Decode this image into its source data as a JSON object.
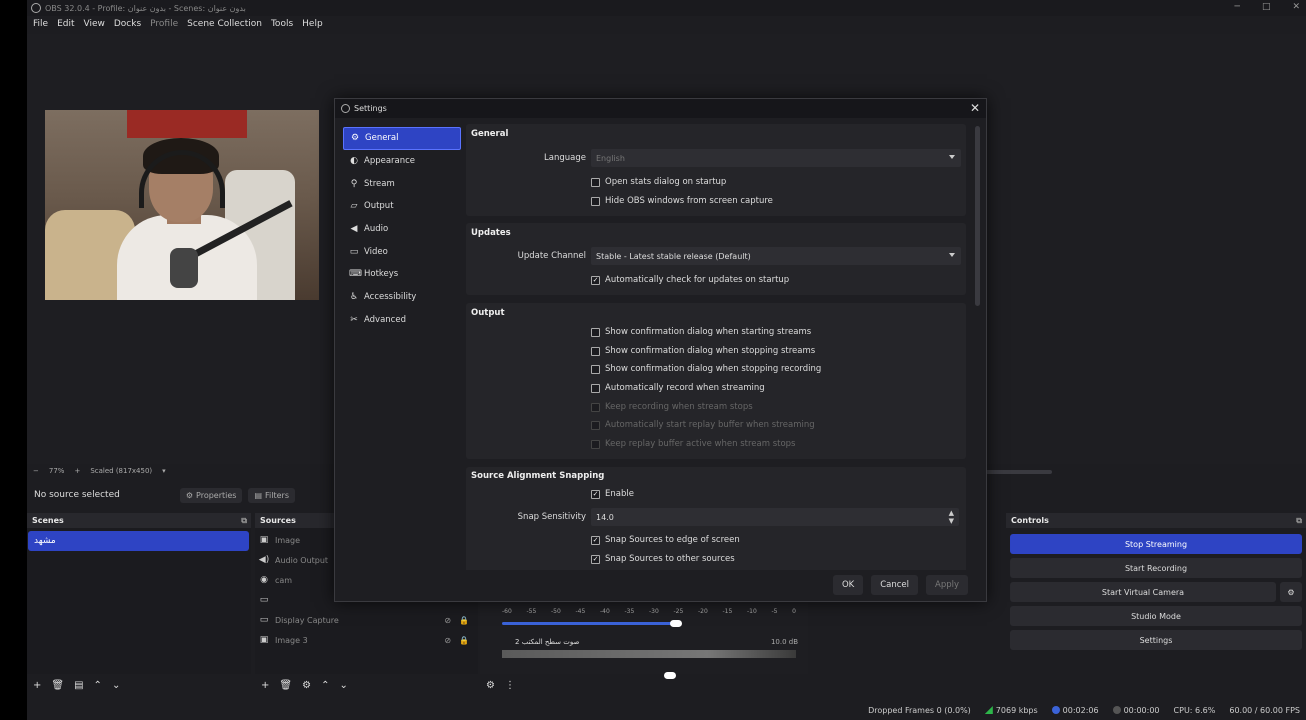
{
  "window": {
    "title": "OBS 32.0.4 - Profile: بدون عنوان - Scenes: بدون عنوان",
    "menus": [
      "File",
      "Edit",
      "View",
      "Docks",
      "Profile",
      "Scene Collection",
      "Tools",
      "Help"
    ]
  },
  "preview": {
    "zoom": "77%",
    "scaled": "Scaled (817x450)"
  },
  "source_bar": {
    "no_source": "No source selected",
    "properties": "Properties",
    "filters": "Filters"
  },
  "scenes": {
    "title": "Scenes",
    "items": [
      "مشهد"
    ]
  },
  "sources": {
    "title": "Sources",
    "items": [
      {
        "label": "Image",
        "icon": "image-icon"
      },
      {
        "label": "Audio Output",
        "icon": "speaker-icon"
      },
      {
        "label": "cam",
        "icon": "camera-icon"
      },
      {
        "label": "",
        "icon": "monitor-icon"
      },
      {
        "label": "Display Capture",
        "icon": "monitor-icon"
      },
      {
        "label": "Image 3",
        "icon": "image-icon"
      }
    ]
  },
  "mixer": {
    "ticks": [
      "-60",
      "-55",
      "-50",
      "-45",
      "-40",
      "-35",
      "-30",
      "-25",
      "-20",
      "-15",
      "-10",
      "-5",
      "0"
    ],
    "channel2_name": "صوت سطح المكتب 2",
    "channel2_db": "10.0 dB"
  },
  "controls": {
    "title": "Controls",
    "buttons": [
      "Stop Streaming",
      "Start Recording",
      "Start Virtual Camera",
      "Studio Mode",
      "Settings"
    ]
  },
  "status": {
    "dropped": "Dropped Frames 0 (0.0%)",
    "bitrate": "7069 kbps",
    "stream_time": "00:02:06",
    "rec_time": "00:00:00",
    "cpu": "CPU: 6.6%",
    "fps": "60.00 / 60.00 FPS"
  },
  "settings": {
    "title": "Settings",
    "nav": [
      {
        "label": "General",
        "icon": "gear-icon"
      },
      {
        "label": "Appearance",
        "icon": "palette-icon"
      },
      {
        "label": "Stream",
        "icon": "antenna-icon"
      },
      {
        "label": "Output",
        "icon": "output-icon"
      },
      {
        "label": "Audio",
        "icon": "speaker-icon"
      },
      {
        "label": "Video",
        "icon": "monitor-icon"
      },
      {
        "label": "Hotkeys",
        "icon": "keyboard-icon"
      },
      {
        "label": "Accessibility",
        "icon": "accessibility-icon"
      },
      {
        "label": "Advanced",
        "icon": "wrench-icon"
      }
    ],
    "general": {
      "title": "General",
      "language_label": "Language",
      "language_value": "English",
      "open_stats": "Open stats dialog on startup",
      "hide_obs": "Hide OBS windows from screen capture"
    },
    "updates": {
      "title": "Updates",
      "channel_label": "Update Channel",
      "channel_value": "Stable - Latest stable release (Default)",
      "auto_check": "Automatically check for updates on startup"
    },
    "output": {
      "title": "Output",
      "options": [
        {
          "label": "Show confirmation dialog when starting streams",
          "checked": false,
          "enabled": true
        },
        {
          "label": "Show confirmation dialog when stopping streams",
          "checked": false,
          "enabled": true
        },
        {
          "label": "Show confirmation dialog when stopping recording",
          "checked": false,
          "enabled": true
        },
        {
          "label": "Automatically record when streaming",
          "checked": false,
          "enabled": true
        },
        {
          "label": "Keep recording when stream stops",
          "checked": false,
          "enabled": false
        },
        {
          "label": "Automatically start replay buffer when streaming",
          "checked": false,
          "enabled": false
        },
        {
          "label": "Keep replay buffer active when stream stops",
          "checked": false,
          "enabled": false
        }
      ]
    },
    "snapping": {
      "title": "Source Alignment Snapping",
      "enable": "Enable",
      "sensitivity_label": "Snap Sensitivity",
      "sensitivity_value": "14.0",
      "edge": "Snap Sources to edge of screen",
      "other": "Snap Sources to other sources"
    },
    "buttons": {
      "ok": "OK",
      "cancel": "Cancel",
      "apply": "Apply"
    }
  }
}
